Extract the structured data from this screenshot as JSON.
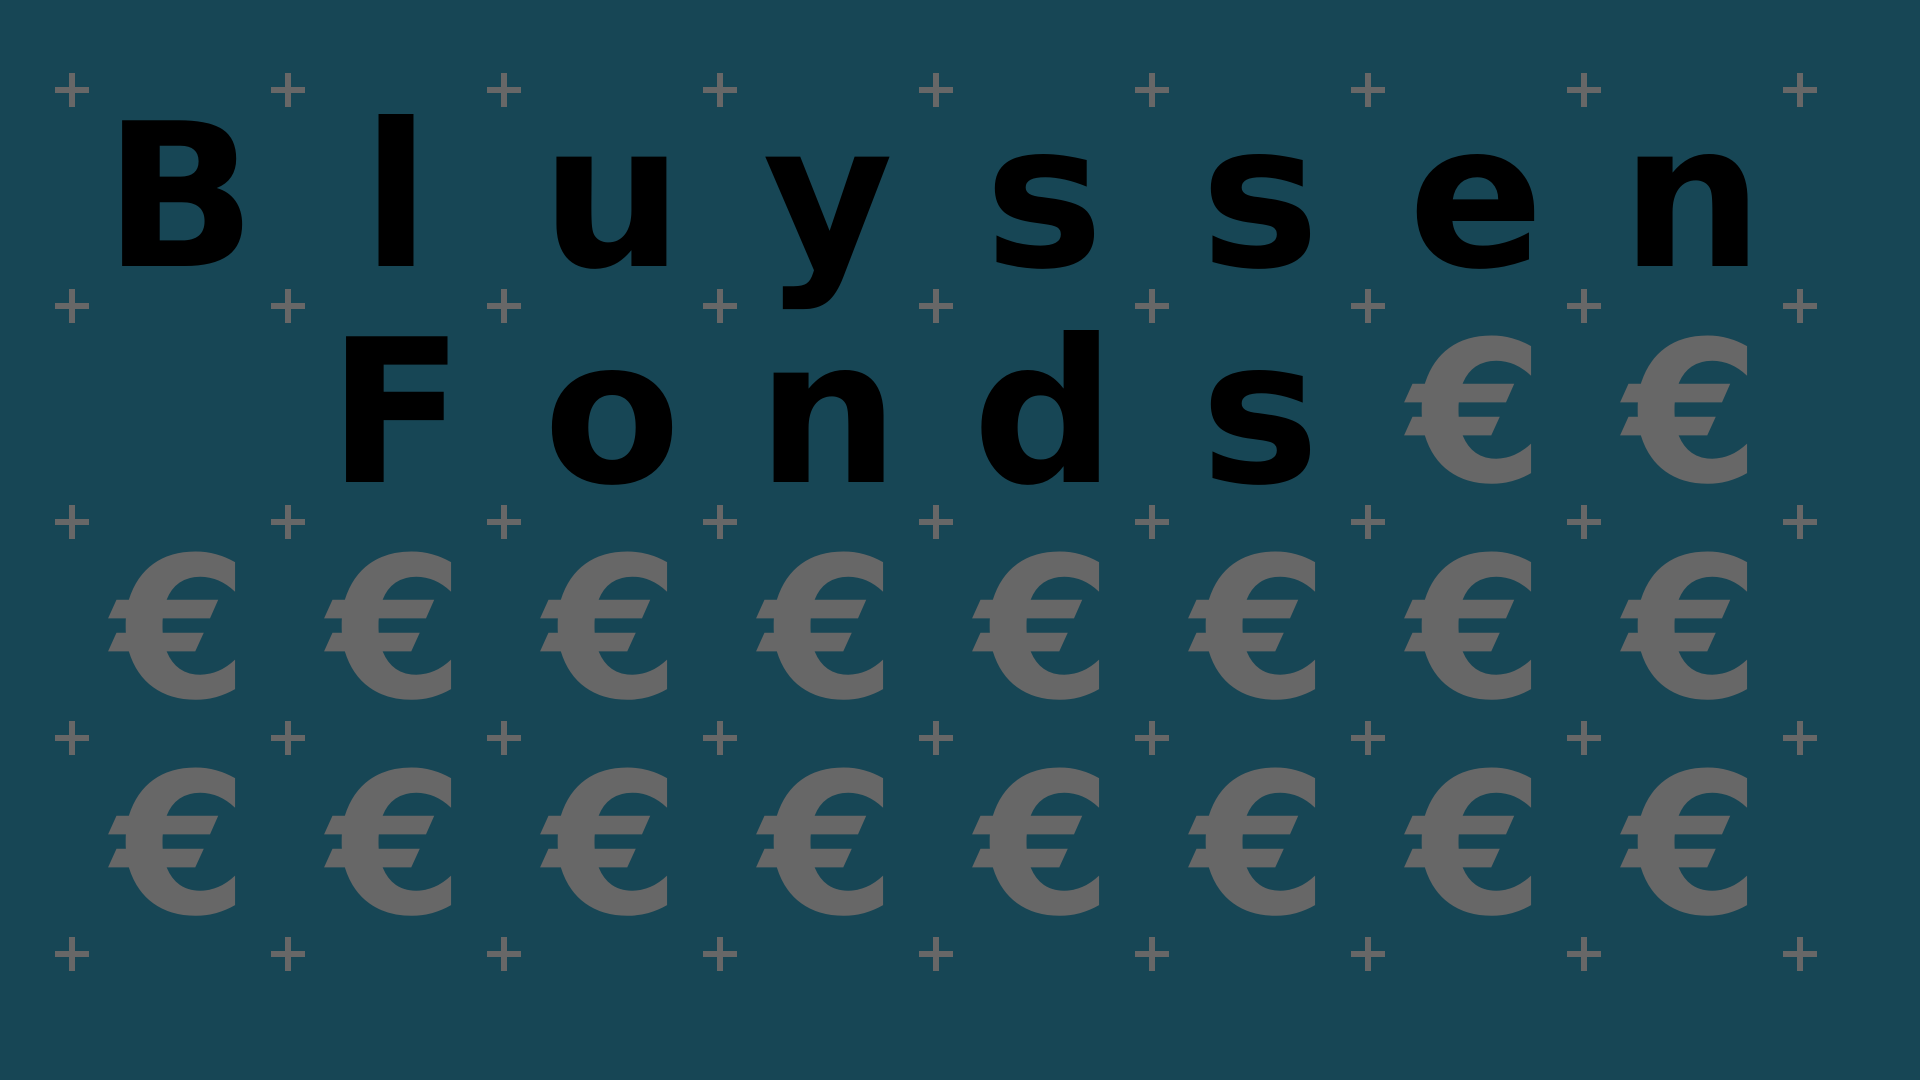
{
  "title_lines": [
    "Bluyssen",
    "Fonds"
  ],
  "rows": [
    [
      "B",
      "l",
      "u",
      "y",
      "s",
      "s",
      "e",
      "n"
    ],
    [
      "",
      "F",
      "o",
      "n",
      "d",
      "s",
      "€",
      "€"
    ],
    [
      "€",
      "€",
      "€",
      "€",
      "€",
      "€",
      "€",
      "€"
    ],
    [
      "€",
      "€",
      "€",
      "€",
      "€",
      "€",
      "€",
      "€"
    ]
  ],
  "colors": {
    "background": "#174655",
    "title": "#000000",
    "euro": "#676767",
    "plus": "#676767"
  },
  "icons": {
    "plus": "plus-icon",
    "euro": "euro-icon"
  }
}
